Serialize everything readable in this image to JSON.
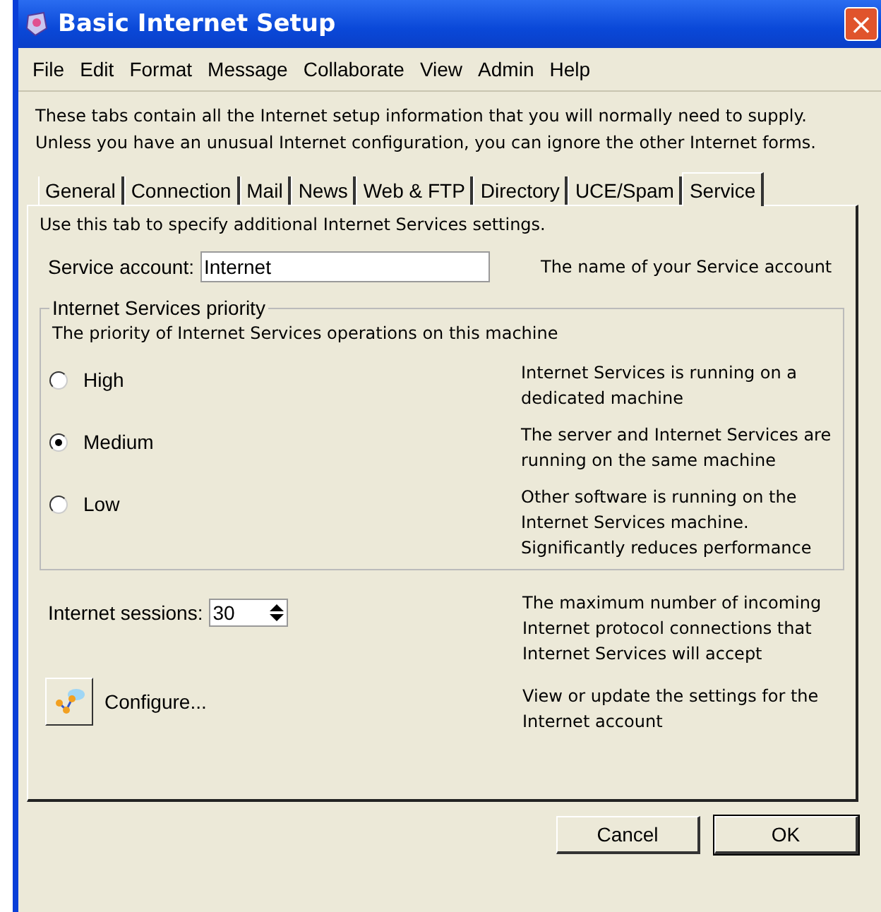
{
  "window": {
    "title": "Basic Internet Setup",
    "close": "×"
  },
  "menu": [
    "File",
    "Edit",
    "Format",
    "Message",
    "Collaborate",
    "View",
    "Admin",
    "Help"
  ],
  "intro": [
    "These tabs contain all the Internet setup information that you will normally need to supply.",
    "Unless you have an unusual Internet configuration, you can ignore the other Internet forms."
  ],
  "tabs": [
    {
      "label": "General",
      "selected": false
    },
    {
      "label": "Connection",
      "selected": false
    },
    {
      "label": "Mail",
      "selected": false
    },
    {
      "label": "News",
      "selected": false
    },
    {
      "label": "Web & FTP",
      "selected": false
    },
    {
      "label": "Directory",
      "selected": false
    },
    {
      "label": "UCE/Spam",
      "selected": false
    },
    {
      "label": "Service",
      "selected": true
    }
  ],
  "panel": {
    "hint": "Use this tab to specify additional Internet Services settings.",
    "service_account": {
      "label": "Service account:",
      "value": "Internet",
      "note": "The name of your Service account"
    },
    "priority": {
      "title": "Internet Services priority",
      "subtitle": "The priority of Internet Services operations on this machine",
      "options": [
        {
          "label": "High",
          "selected": false,
          "note": "Internet Services is running on a dedicated machine"
        },
        {
          "label": "Medium",
          "selected": true,
          "note": "The server and Internet Services are running on the same machine"
        },
        {
          "label": "Low",
          "selected": false,
          "note": "Other software is running on the Internet Services machine. Significantly reduces performance"
        }
      ]
    },
    "sessions": {
      "label": "Internet sessions:",
      "value": "30",
      "note": "The maximum number of incoming Internet protocol connections that Internet Services will accept"
    },
    "configure": {
      "label": "Configure...",
      "note": "View or update the settings for the Internet account"
    }
  },
  "buttons": [
    "Cancel",
    "OK"
  ]
}
